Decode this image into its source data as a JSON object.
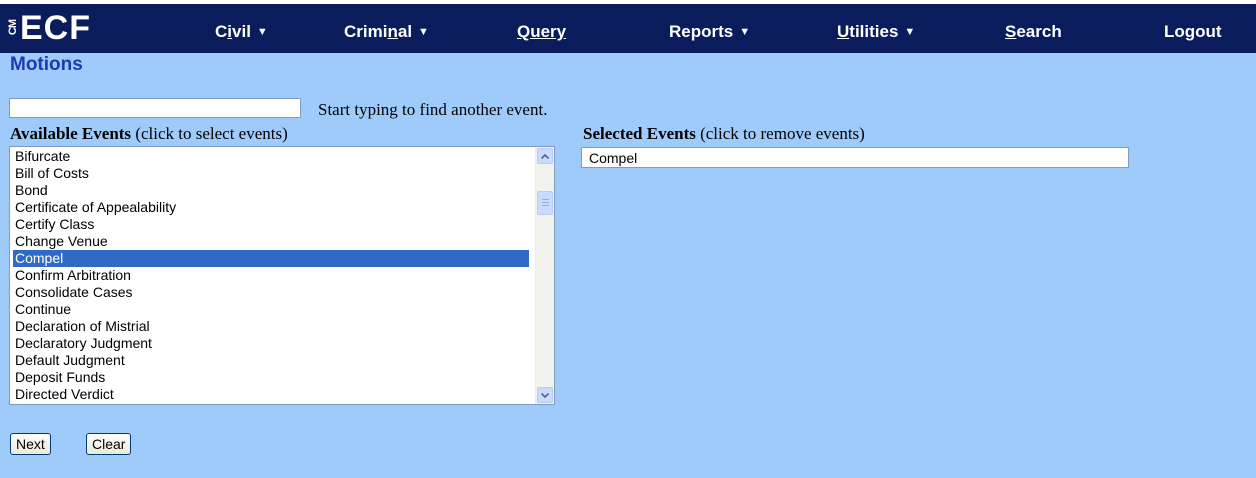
{
  "logo": {
    "cm": "CM",
    "ecf": "ECF"
  },
  "nav": {
    "civil": {
      "pre": "C",
      "ul": "i",
      "post": "vil"
    },
    "criminal": {
      "pre": "Crimi",
      "ul": "n",
      "post": "al"
    },
    "query": "Query",
    "reports": "Reports",
    "utilities": {
      "ul": "U",
      "post": "tilities"
    },
    "search": {
      "ul": "S",
      "post": "earch"
    },
    "logout": "Logout"
  },
  "page_title": "Motions",
  "search": {
    "value": "",
    "hint": "Start typing to find another event."
  },
  "available": {
    "header_bold": "Available Events",
    "header_rest": " (click to select events)",
    "items": [
      "Bifurcate",
      "Bill of Costs",
      "Bond",
      "Certificate of Appealability",
      "Certify Class",
      "Change Venue",
      "Compel",
      "Confirm Arbitration",
      "Consolidate Cases",
      "Continue",
      "Declaration of Mistrial",
      "Declaratory Judgment",
      "Default Judgment",
      "Deposit Funds",
      "Directed Verdict"
    ],
    "selected_item": "Compel"
  },
  "selected": {
    "header_bold": "Selected Events",
    "header_rest": " (click to remove events)",
    "items": [
      "Compel"
    ]
  },
  "buttons": {
    "next": "Next",
    "clear": "Clear"
  },
  "colors": {
    "navbar": "#0a1c5c",
    "background": "#9ecbfa",
    "title": "#1f38b5",
    "selection": "#316ac5"
  }
}
